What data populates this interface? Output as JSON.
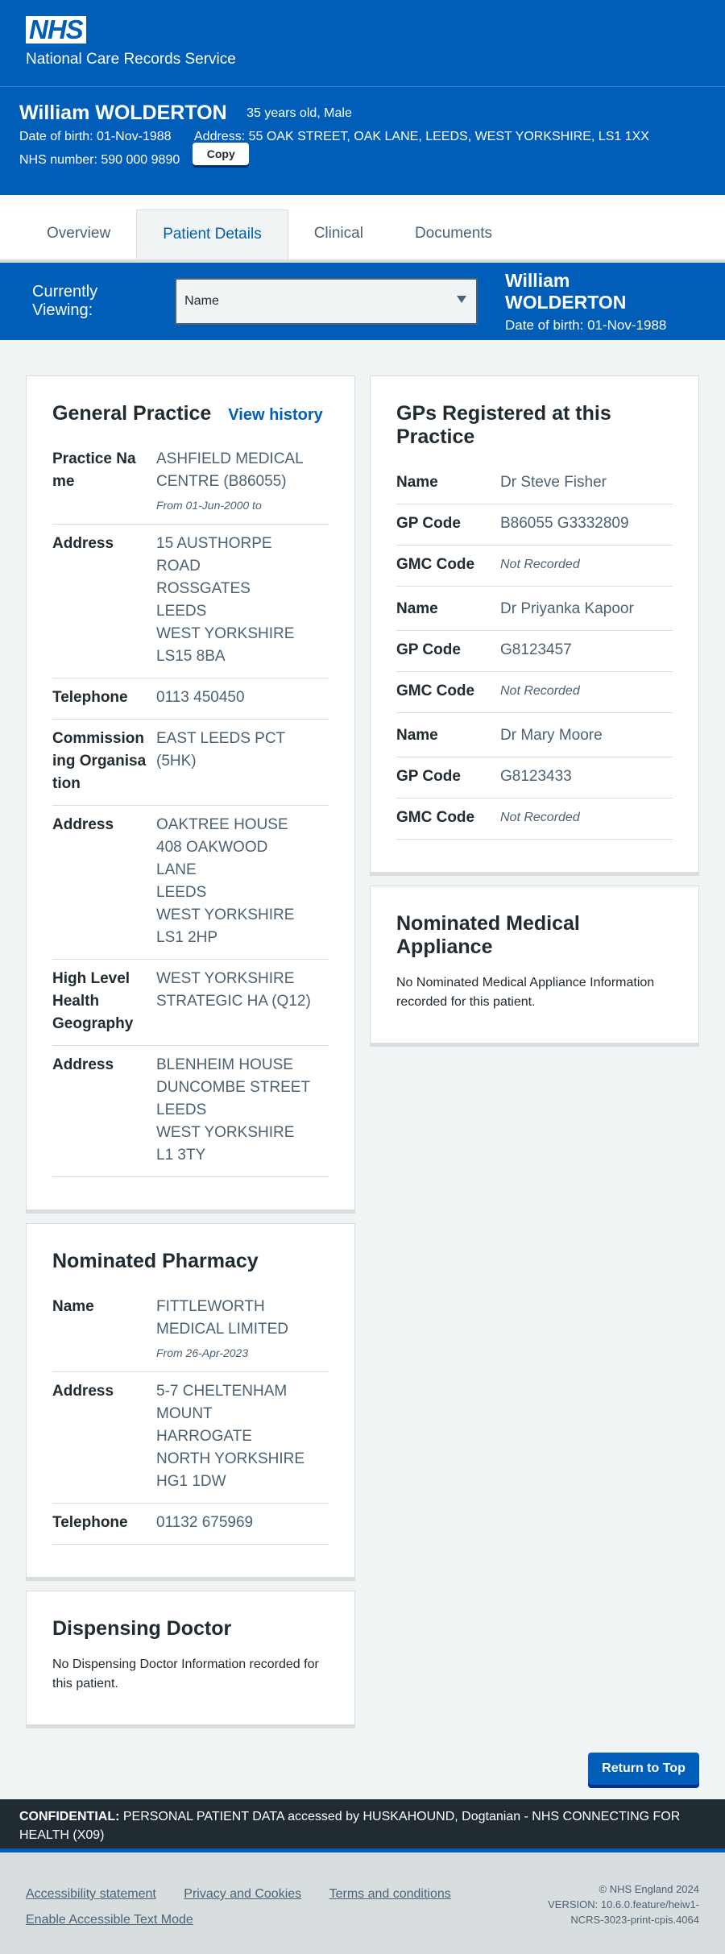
{
  "header": {
    "logo": "NHS",
    "service_name": "National Care Records Service"
  },
  "patient_banner": {
    "name": "William WOLDERTON",
    "age_sex": "35 years old, Male",
    "dob": "Date of birth: 01-Nov-1988",
    "address": "Address: 55 OAK STREET, OAK LANE, LEEDS, WEST YORKSHIRE, LS1 1XX",
    "nhs_number": "NHS number: 590 000 9890",
    "copy_label": "Copy"
  },
  "tabs": [
    {
      "label": "Overview",
      "active": false
    },
    {
      "label": "Patient Details",
      "active": true
    },
    {
      "label": "Clinical",
      "active": false
    },
    {
      "label": "Documents",
      "active": false
    }
  ],
  "viewing_bar": {
    "label": "Currently Viewing:",
    "selected": "Name",
    "patient_name": "William WOLDERTON",
    "patient_dob": "Date of birth: 01-Nov-1988"
  },
  "general_practice": {
    "title": "General Practice",
    "history_link": "View history",
    "practice_name_label": "Practice Name",
    "practice_name": [
      "ASHFIELD MEDICAL",
      "CENTRE (B86055)"
    ],
    "from_date": "From 01-Jun-2000  to",
    "address_label": "Address",
    "address": [
      "15 AUSTHORPE",
      "ROAD",
      "ROSSGATES",
      "LEEDS",
      "WEST YORKSHIRE",
      "LS15 8BA"
    ],
    "telephone_label": "Telephone",
    "telephone": "0113 450450",
    "commissioning_label": "Commissioning Organisation",
    "commissioning": [
      "EAST LEEDS PCT",
      "(5HK)"
    ],
    "commissioning_address_label": "Address",
    "commissioning_address": [
      "OAKTREE HOUSE",
      "408 OAKWOOD",
      "LANE",
      "LEEDS",
      "WEST YORKSHIRE",
      "LS1 2HP"
    ],
    "hlhg_label": "High Level Health Geography",
    "hlhg": [
      "WEST YORKSHIRE",
      "STRATEGIC HA (Q12)"
    ],
    "hlhg_address_label": "Address",
    "hlhg_address": [
      "BLENHEIM HOUSE",
      "DUNCOMBE STREET",
      "LEEDS",
      "WEST YORKSHIRE",
      "L1 3TY"
    ]
  },
  "nominated_pharmacy": {
    "title": "Nominated Pharmacy",
    "name_label": "Name",
    "name": [
      "FITTLEWORTH",
      "MEDICAL LIMITED"
    ],
    "from_date": "From 26-Apr-2023",
    "address_label": "Address",
    "address": [
      "5-7 CHELTENHAM",
      "MOUNT",
      "HARROGATE",
      "NORTH YORKSHIRE",
      "HG1 1DW"
    ],
    "telephone_label": "Telephone",
    "telephone": "01132 675969"
  },
  "dispensing_doctor": {
    "title": "Dispensing Doctor",
    "note": "No Dispensing Doctor Information recorded for this patient."
  },
  "gps_registered": {
    "title": "GPs Registered at this Practice",
    "name_label": "Name",
    "gp_code_label": "GP Code",
    "gmc_code_label": "GMC Code",
    "gps": [
      {
        "name": "Dr Steve Fisher",
        "gp_code": "B86055 G3332809",
        "gmc_code": "Not Recorded"
      },
      {
        "name": "Dr Priyanka Kapoor",
        "gp_code": "G8123457",
        "gmc_code": "Not Recorded"
      },
      {
        "name": "Dr Mary Moore",
        "gp_code": "G8123433",
        "gmc_code": "Not Recorded"
      }
    ]
  },
  "nominated_appliance": {
    "title": "Nominated Medical Appliance",
    "note": "No Nominated Medical Appliance Information recorded for this patient."
  },
  "return_to_top": "Return to Top",
  "confidential": {
    "prefix": "CONFIDENTIAL:",
    "text": " PERSONAL PATIENT DATA accessed by HUSKAHOUND, Dogtanian - NHS CONNECTING FOR HEALTH (X09)"
  },
  "footer": {
    "links": [
      "Accessibility statement",
      "Privacy and Cookies",
      "Terms and conditions",
      "Enable Accessible Text Mode"
    ],
    "copyright": "© NHS England 2024",
    "version": "VERSION: 10.6.0.feature/heiw1-NCRS-3023-print-cpis.4064"
  }
}
